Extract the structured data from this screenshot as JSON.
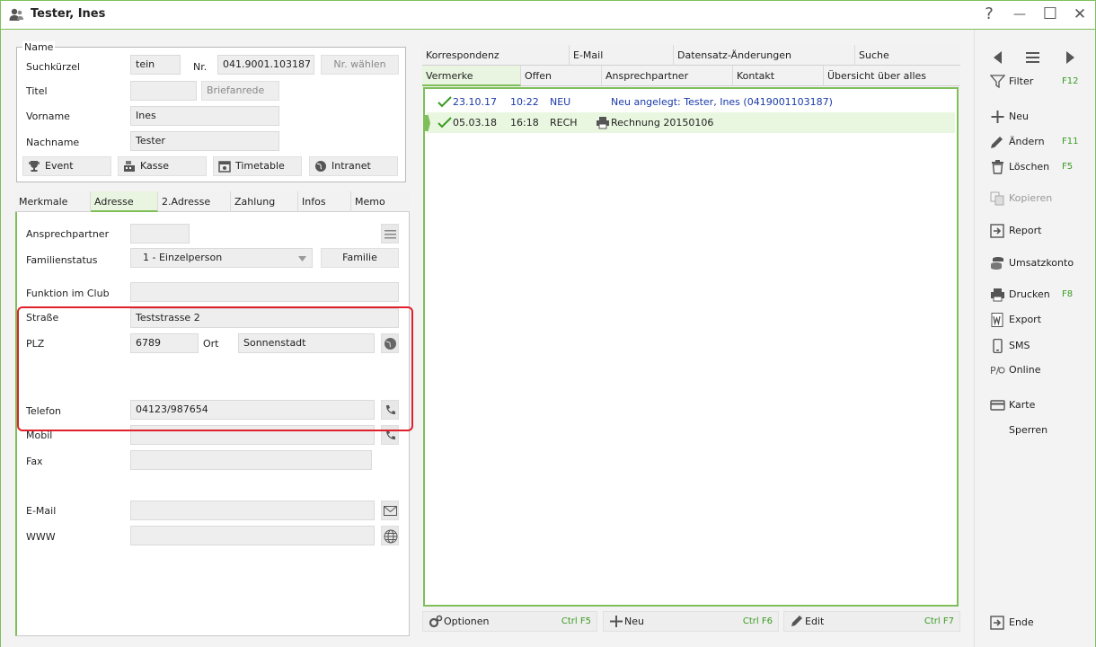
{
  "window": {
    "title": "Tester, Ines",
    "help": "?",
    "minimize": "—",
    "maximize": "☐",
    "close": "✕"
  },
  "name_group": {
    "legend": "Name",
    "suchkuerzel_label": "Suchkürzel",
    "suchkuerzel_value": "tein",
    "nr_label": "Nr.",
    "nr_value": "041.9001.103187",
    "nr_waehlen": "Nr. wählen",
    "titel_label": "Titel",
    "titel_value": "",
    "briefanrede": "Briefanrede",
    "vorname_label": "Vorname",
    "vorname_value": "Ines",
    "nachname_label": "Nachname",
    "nachname_value": "Tester",
    "buttons": [
      "Event",
      "Kasse",
      "Timetable",
      "Intranet"
    ]
  },
  "left_tabs": [
    "Merkmale",
    "Adresse",
    "2.Adresse",
    "Zahlung",
    "Infos",
    "Memo"
  ],
  "address": {
    "ansprechpartner_label": "Ansprechpartner",
    "familienstatus_label": "Familienstatus",
    "familienstatus_value": "1 - Einzelperson",
    "familie_button": "Familie",
    "funktion_label": "Funktion im Club",
    "strasse_label": "Straße",
    "strasse_value": "Teststrasse 2",
    "plz_label": "PLZ",
    "plz_value": "6789",
    "ort_label": "Ort",
    "ort_value": "Sonnenstadt",
    "telefon_label": "Telefon",
    "telefon_value": "04123/987654",
    "mobil_label": "Mobil",
    "fax_label": "Fax",
    "email_label": "E-Mail",
    "www_label": "WWW"
  },
  "right_tabs_row1": [
    "Korrespondenz",
    "E-Mail",
    "Datensatz-Änderungen",
    "Suche"
  ],
  "right_tabs_row2": [
    "Vermerke",
    "Offen",
    "Ansprechpartner",
    "Kontakt",
    "Übersicht über alles"
  ],
  "entries": [
    {
      "date": "23.10.17",
      "time": "10:22",
      "type": "NEU",
      "text": "Neu angelegt: Tester, Ines (0419001103187)"
    },
    {
      "date": "05.03.18",
      "time": "16:18",
      "type": "RECH",
      "text": "Rechnung   20150106"
    }
  ],
  "bottom_buttons": [
    {
      "label": "Optionen",
      "key": "Ctrl F5"
    },
    {
      "label": "Neu",
      "key": "Ctrl F6"
    },
    {
      "label": "Edit",
      "key": "Ctrl F7"
    }
  ],
  "sidebar": {
    "filter": "Filter",
    "filter_key": "F12",
    "neu": "Neu",
    "aendern": "Ändern",
    "aendern_key": "F11",
    "loeschen": "Löschen",
    "loeschen_key": "F5",
    "kopieren": "Kopieren",
    "report": "Report",
    "umsatzkonto": "Umsatzkonto",
    "drucken": "Drucken",
    "drucken_key": "F8",
    "export": "Export",
    "sms": "SMS",
    "online": "Online",
    "karte": "Karte",
    "sperren": "Sperren",
    "ende": "Ende"
  },
  "colors": {
    "accent": "#7fbf5a",
    "highlight": "#e0202a",
    "link": "#1a3aa8",
    "shortcut": "#3a9b22"
  }
}
